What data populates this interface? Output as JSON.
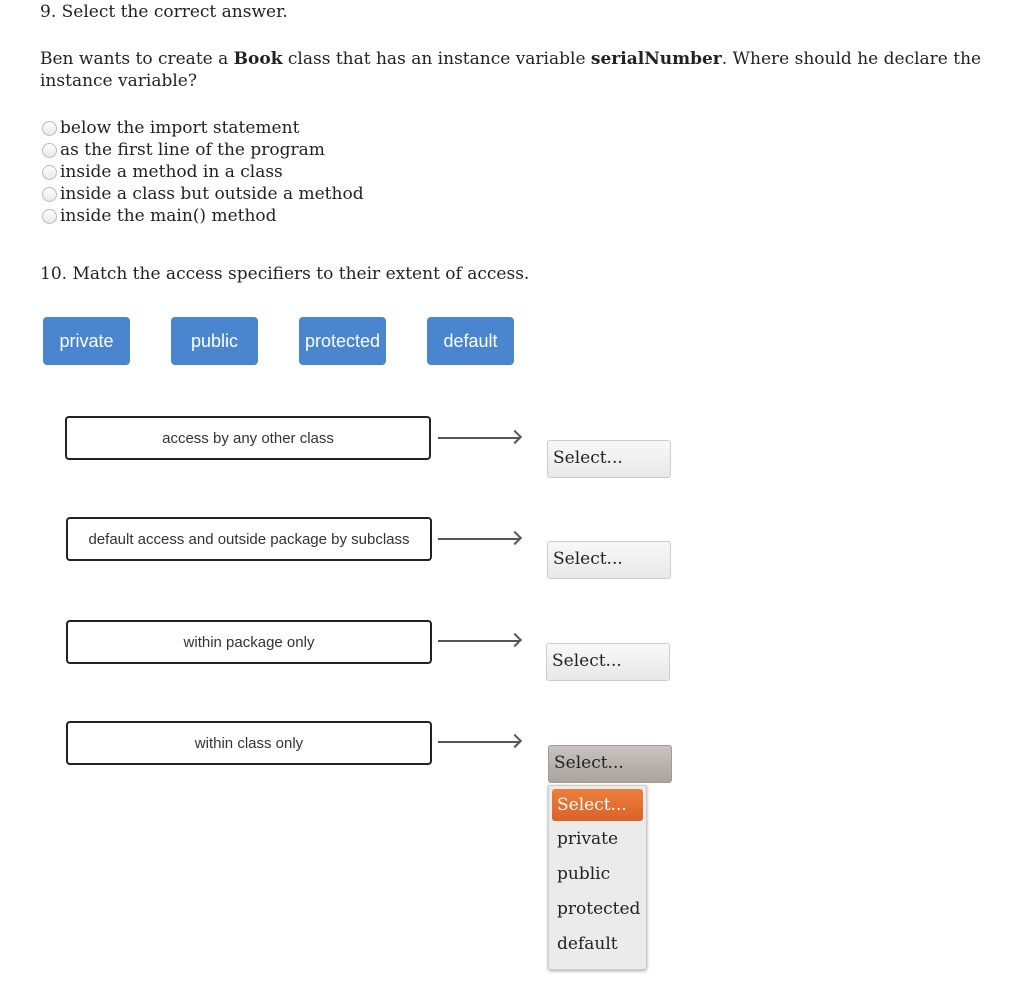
{
  "q9": {
    "title": "9.  Select the correct answer.",
    "prompt_pre": "Ben wants to create a ",
    "prompt_b1": "Book",
    "prompt_mid": " class that has an instance variable ",
    "prompt_b2": "serialNumber",
    "prompt_post": ". Where should he declare the instance variable?",
    "options": [
      "below the import statement",
      "as the first line of the program",
      "inside a method in a class",
      "inside a class but outside a method",
      "inside the main() method"
    ]
  },
  "q10": {
    "title": "10.  Match the access specifiers to their extent of access.",
    "chips": [
      "private",
      "public",
      "protected",
      "default"
    ],
    "rows": [
      {
        "label": "access by any other class",
        "select": "Select..."
      },
      {
        "label": "default access and outside package by subclass",
        "select": "Select..."
      },
      {
        "label": "within package only",
        "select": "Select..."
      },
      {
        "label": "within class only",
        "select": "Select..."
      }
    ],
    "dropdown": [
      "Select...",
      "private",
      "public",
      "protected",
      "default"
    ],
    "colors": {
      "chip": "#4a86cf",
      "highlight": "#e06d32"
    }
  }
}
